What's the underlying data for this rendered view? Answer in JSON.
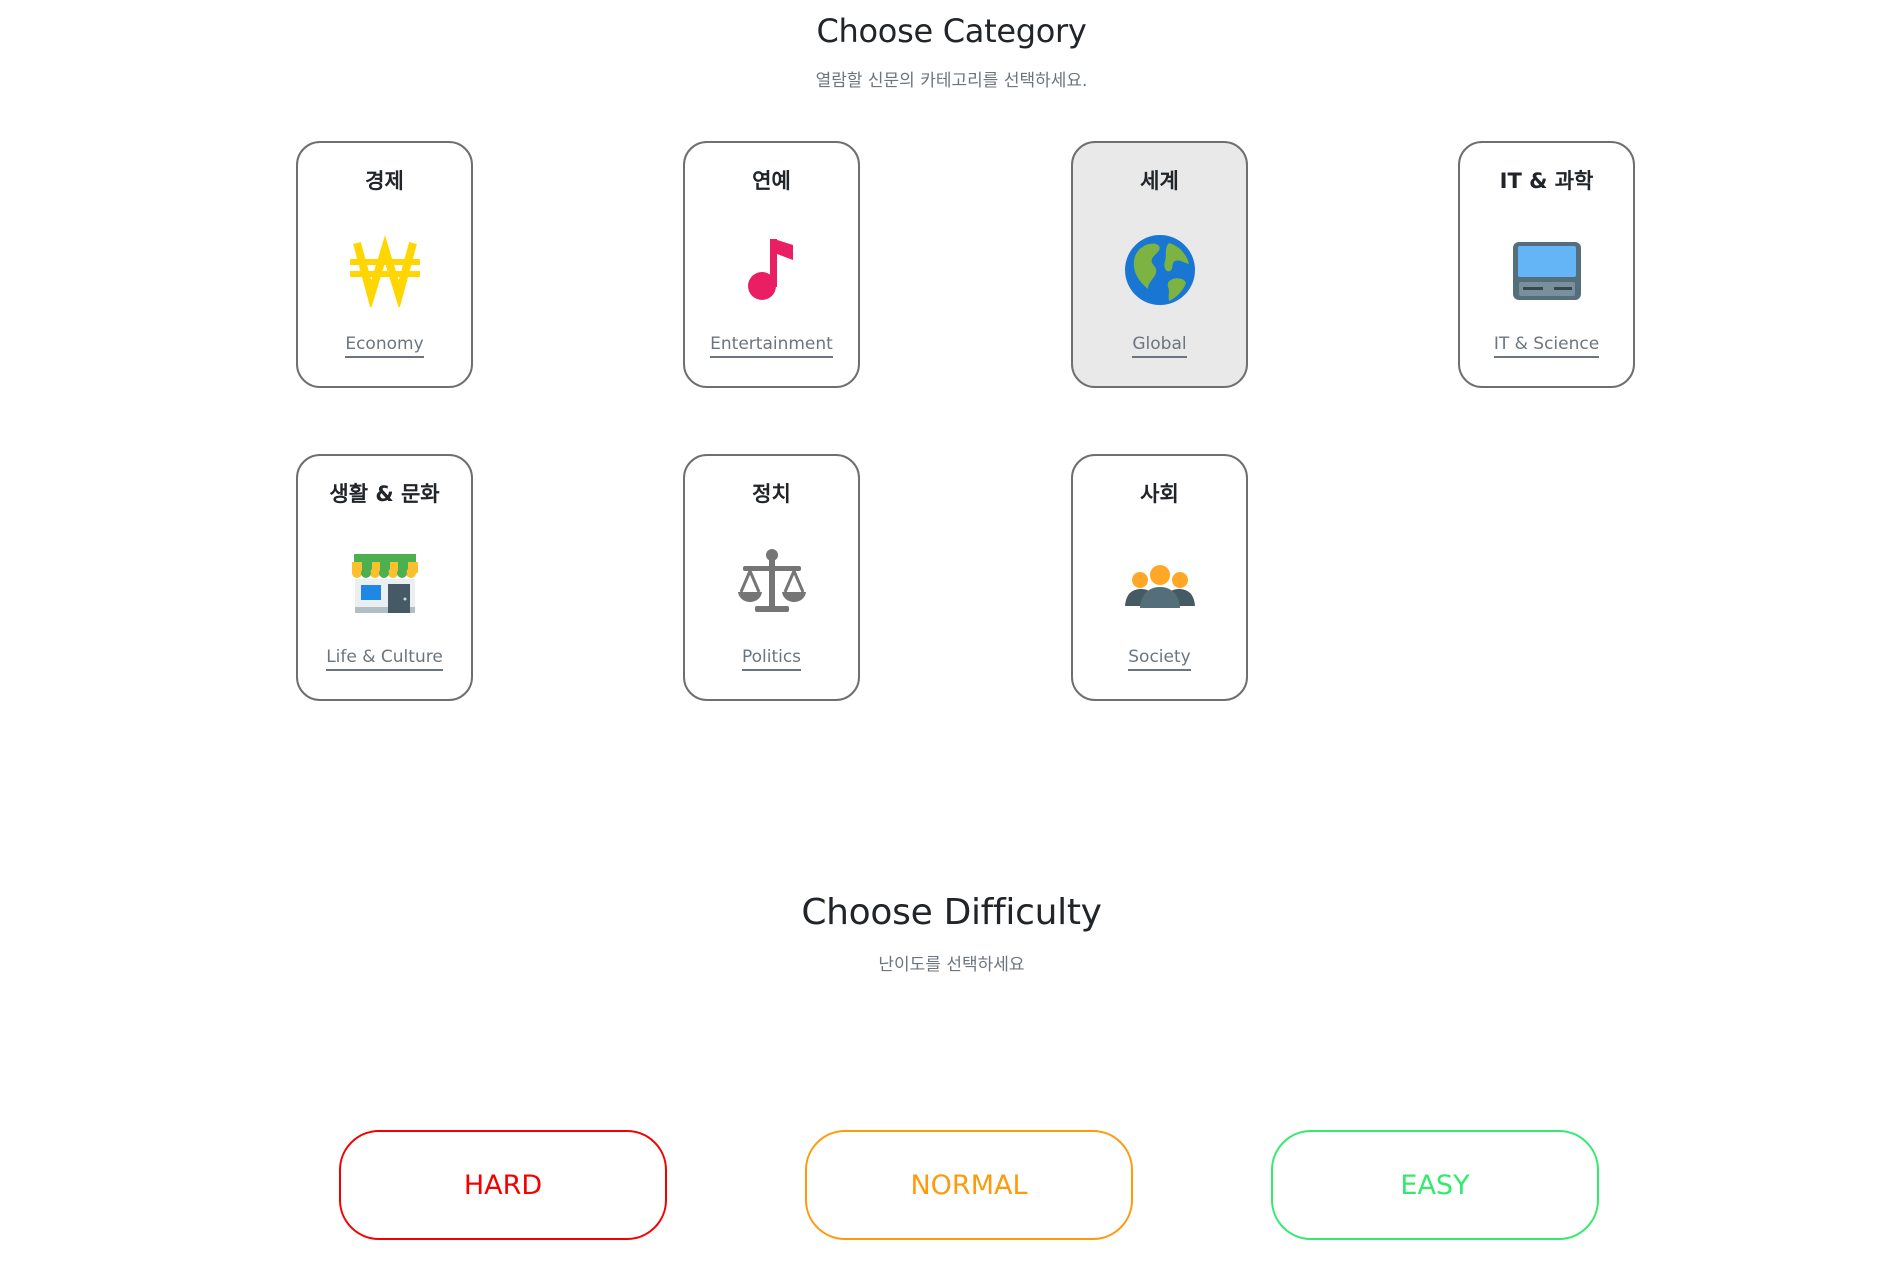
{
  "category_section": {
    "title": "Choose Category",
    "subtitle": "열람할 신문의 카테고리를 선택하세요."
  },
  "categories": [
    {
      "title": "경제",
      "label": "Economy",
      "icon": "won-sign-icon",
      "selected": false
    },
    {
      "title": "연예",
      "label": "Entertainment",
      "icon": "music-note-icon",
      "selected": false
    },
    {
      "title": "세계",
      "label": "Global",
      "icon": "globe-icon",
      "selected": true
    },
    {
      "title": "IT & 과학",
      "label": "IT & Science",
      "icon": "computer-icon",
      "selected": false
    },
    {
      "title": "생활 & 문화",
      "label": "Life & Culture",
      "icon": "store-icon",
      "selected": false
    },
    {
      "title": "정치",
      "label": "Politics",
      "icon": "scales-icon",
      "selected": false
    },
    {
      "title": "사회",
      "label": "Society",
      "icon": "people-icon",
      "selected": false
    }
  ],
  "difficulty_section": {
    "title": "Choose Difficulty",
    "subtitle": "난이도를 선택하세요"
  },
  "difficulties": [
    {
      "label": "HARD",
      "color": "#f40000"
    },
    {
      "label": "NORMAL",
      "color": "#ff9a0c"
    },
    {
      "label": "EASY",
      "color": "#33ea6e"
    }
  ]
}
